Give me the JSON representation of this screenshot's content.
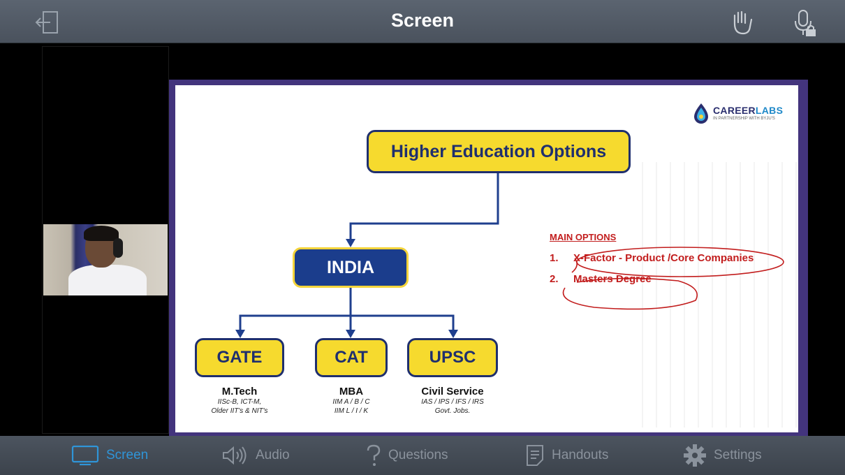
{
  "header": {
    "title": "Screen"
  },
  "slide": {
    "logo": {
      "brand_a": "CAREER",
      "brand_b": "LABS",
      "tagline": "IN PARTNERSHIP WITH BYJU'S"
    },
    "root": "Higher Education Options",
    "india": "INDIA",
    "branches": [
      {
        "label": "GATE",
        "heading": "M.Tech",
        "detail1": "IISc-B, ICT-M,",
        "detail2": "Older IIT's & NIT's"
      },
      {
        "label": "CAT",
        "heading": "MBA",
        "detail1": "IIM A / B / C",
        "detail2": "IIM L / I / K"
      },
      {
        "label": "UPSC",
        "heading": "Civil Service",
        "detail1": "IAS / IPS / IFS / IRS",
        "detail2": "Govt. Jobs."
      }
    ],
    "main_options": {
      "header": "MAIN OPTIONS",
      "items": [
        {
          "num": "1.",
          "text": "X-Factor - Product /Core Companies"
        },
        {
          "num": "2.",
          "text": "Masters Degree"
        }
      ]
    }
  },
  "tabs": [
    {
      "label": "Screen",
      "icon": "monitor-icon",
      "active": true
    },
    {
      "label": "Audio",
      "icon": "speaker-icon",
      "active": false
    },
    {
      "label": "Questions",
      "icon": "question-icon",
      "active": false
    },
    {
      "label": "Handouts",
      "icon": "document-icon",
      "active": false
    },
    {
      "label": "Settings",
      "icon": "gear-icon",
      "active": false
    }
  ],
  "colors": {
    "active_tab": "#2f95d8",
    "inactive_tab": "#8a929c",
    "slide_border": "#43347d",
    "box_yellow": "#f6da2e",
    "box_navy": "#1b3d8c",
    "annotation_red": "#c21d1d"
  }
}
